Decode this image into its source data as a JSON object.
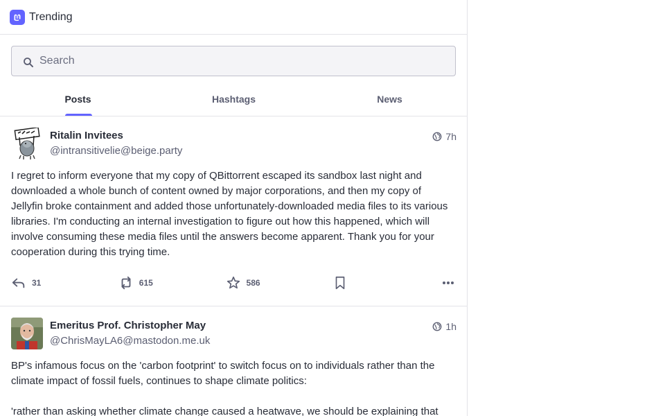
{
  "header": {
    "title": "Trending",
    "logo_icon": "mastodon-logo-icon"
  },
  "search": {
    "placeholder": "Search"
  },
  "tabs": [
    {
      "label": "Posts",
      "active": true
    },
    {
      "label": "Hashtags",
      "active": false
    },
    {
      "label": "News",
      "active": false
    }
  ],
  "posts": [
    {
      "display_name": "Ritalin Invitees",
      "handle": "@intransitivelie@beige.party",
      "visibility_icon": "globe-icon",
      "time": "7h",
      "paragraphs": [
        "I regret to inform everyone that my copy of QBittorrent escaped its sandbox last night and downloaded a whole bunch of content owned by major corporations, and then my copy of Jellyfin broke containment and added those unfortunately-downloaded media files to its various libraries. I'm conducting an internal investigation to figure out how this happened, which will involve consuming these media files until the answers become apparent. Thank you for your cooperation during this trying time."
      ],
      "replies": "31",
      "boosts": "615",
      "favourites": "586"
    },
    {
      "display_name": "Emeritus Prof. Christopher May",
      "handle": "@ChrisMayLA6@mastodon.me.uk",
      "visibility_icon": "globe-icon",
      "time": "1h",
      "paragraphs": [
        "BP's infamous focus on the 'carbon footprint' to switch focus on to individuals rather than the climate impact of fossil fuels, continues to shape climate politics:",
        "'rather than asking whether climate change caused a heatwave, we should be explaining that"
      ]
    }
  ],
  "colors": {
    "accent": "#6364ff",
    "text": "#282c37",
    "muted": "#5b5e72",
    "border": "#e3e3e8"
  }
}
